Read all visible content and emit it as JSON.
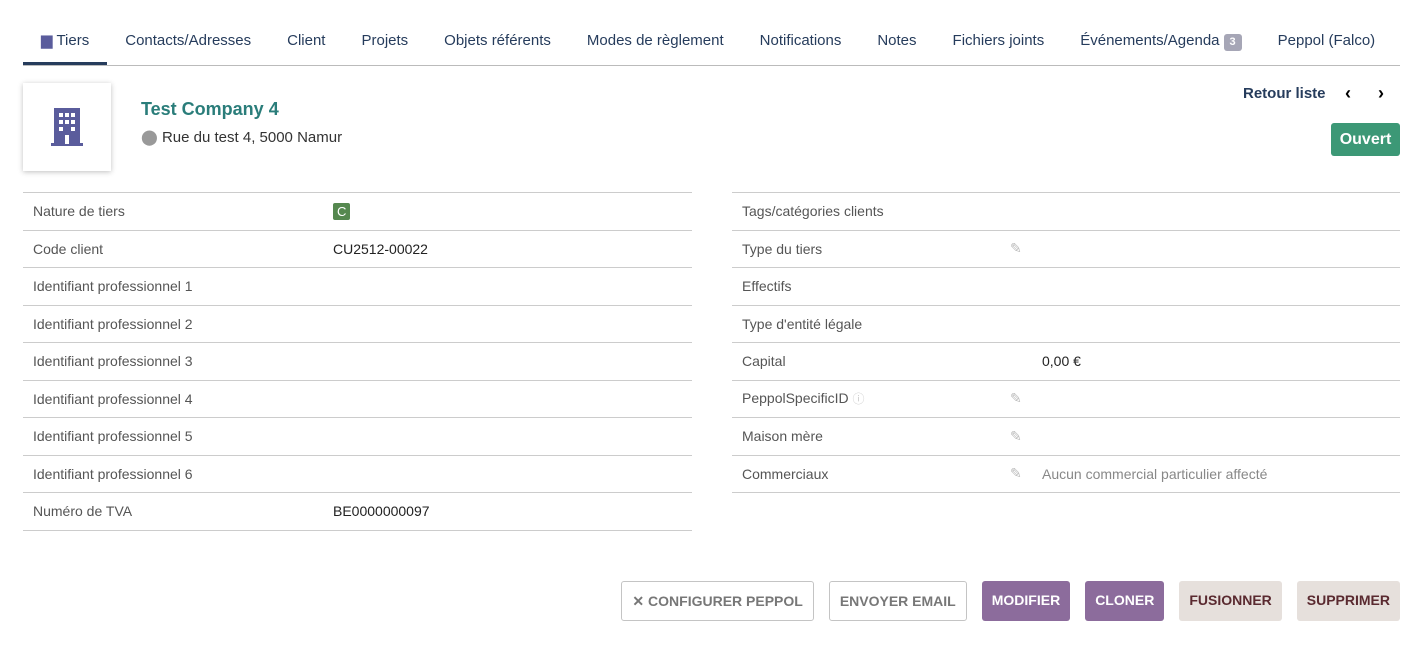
{
  "tabs": [
    {
      "label": "Tiers"
    },
    {
      "label": "Contacts/Adresses"
    },
    {
      "label": "Client"
    },
    {
      "label": "Projets"
    },
    {
      "label": "Objets référents"
    },
    {
      "label": "Modes de règlement"
    },
    {
      "label": "Notifications"
    },
    {
      "label": "Notes"
    },
    {
      "label": "Fichiers joints"
    },
    {
      "label": "Événements/Agenda",
      "badge": "3"
    },
    {
      "label": "Peppol (Falco)"
    }
  ],
  "company": {
    "name": "Test Company 4",
    "address": "Rue du test 4, 5000 Namur",
    "status": "Ouvert"
  },
  "nav": {
    "back": "Retour liste",
    "prev": "‹",
    "next": "›"
  },
  "left": [
    {
      "label": "Nature de tiers",
      "value": "C"
    },
    {
      "label": "Code client",
      "value": "CU2512-00022"
    },
    {
      "label": "Identifiant professionnel 1",
      "value": ""
    },
    {
      "label": "Identifiant professionnel 2",
      "value": ""
    },
    {
      "label": "Identifiant professionnel 3",
      "value": ""
    },
    {
      "label": "Identifiant professionnel 4",
      "value": ""
    },
    {
      "label": "Identifiant professionnel 5",
      "value": ""
    },
    {
      "label": "Identifiant professionnel 6",
      "value": ""
    },
    {
      "label": "Numéro de TVA",
      "value": "BE0000000097"
    }
  ],
  "right": [
    {
      "label": "Tags/catégories clients",
      "value": ""
    },
    {
      "label": "Type du tiers",
      "value": ""
    },
    {
      "label": "Effectifs",
      "value": ""
    },
    {
      "label": "Type d'entité légale",
      "value": ""
    },
    {
      "label": "Capital",
      "value": "0,00 €"
    },
    {
      "label": "PeppolSpecificID",
      "value": ""
    },
    {
      "label": "Maison mère",
      "value": ""
    },
    {
      "label": "Commerciaux",
      "value": "Aucun commercial particulier affecté"
    }
  ],
  "buttons": {
    "peppol": "✕ CONFIGURER PEPPOL",
    "email": "ENVOYER EMAIL",
    "modify": "MODIFIER",
    "clone": "CLONER",
    "merge": "FUSIONNER",
    "delete": "SUPPRIMER"
  }
}
